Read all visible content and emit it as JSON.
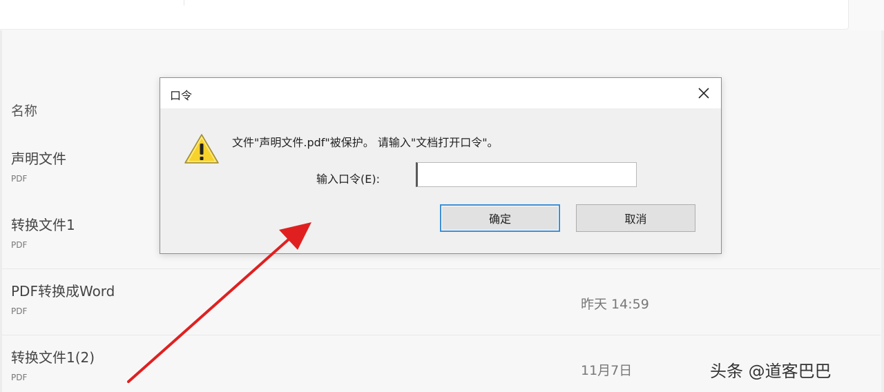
{
  "file_list": {
    "column_header": "名称",
    "files": [
      {
        "name": "声明文件",
        "type": "PDF",
        "date": ""
      },
      {
        "name": "转换文件1",
        "type": "PDF",
        "date": ""
      },
      {
        "name": "PDF转换成Word",
        "type": "PDF",
        "date": "昨天 14:59"
      },
      {
        "name": "转换文件1(2)",
        "type": "PDF",
        "date": "11月7日"
      }
    ]
  },
  "dialog": {
    "title": "口令",
    "message": "文件\"声明文件.pdf\"被保护。 请输入\"文档打开口令\"。",
    "password_label": "输入口令(E):",
    "password_value": "",
    "ok_label": "确定",
    "cancel_label": "取消",
    "icon": "warning-icon",
    "close_icon": "close-icon"
  },
  "annotation": {
    "arrow_color": "#e02020"
  },
  "colors": {
    "focus_border": "#3b8fd6",
    "dialog_background": "#f0f0f0",
    "warning_fill": "#f7d22b"
  },
  "watermark": {
    "text": "头条 @道客巴巴"
  }
}
